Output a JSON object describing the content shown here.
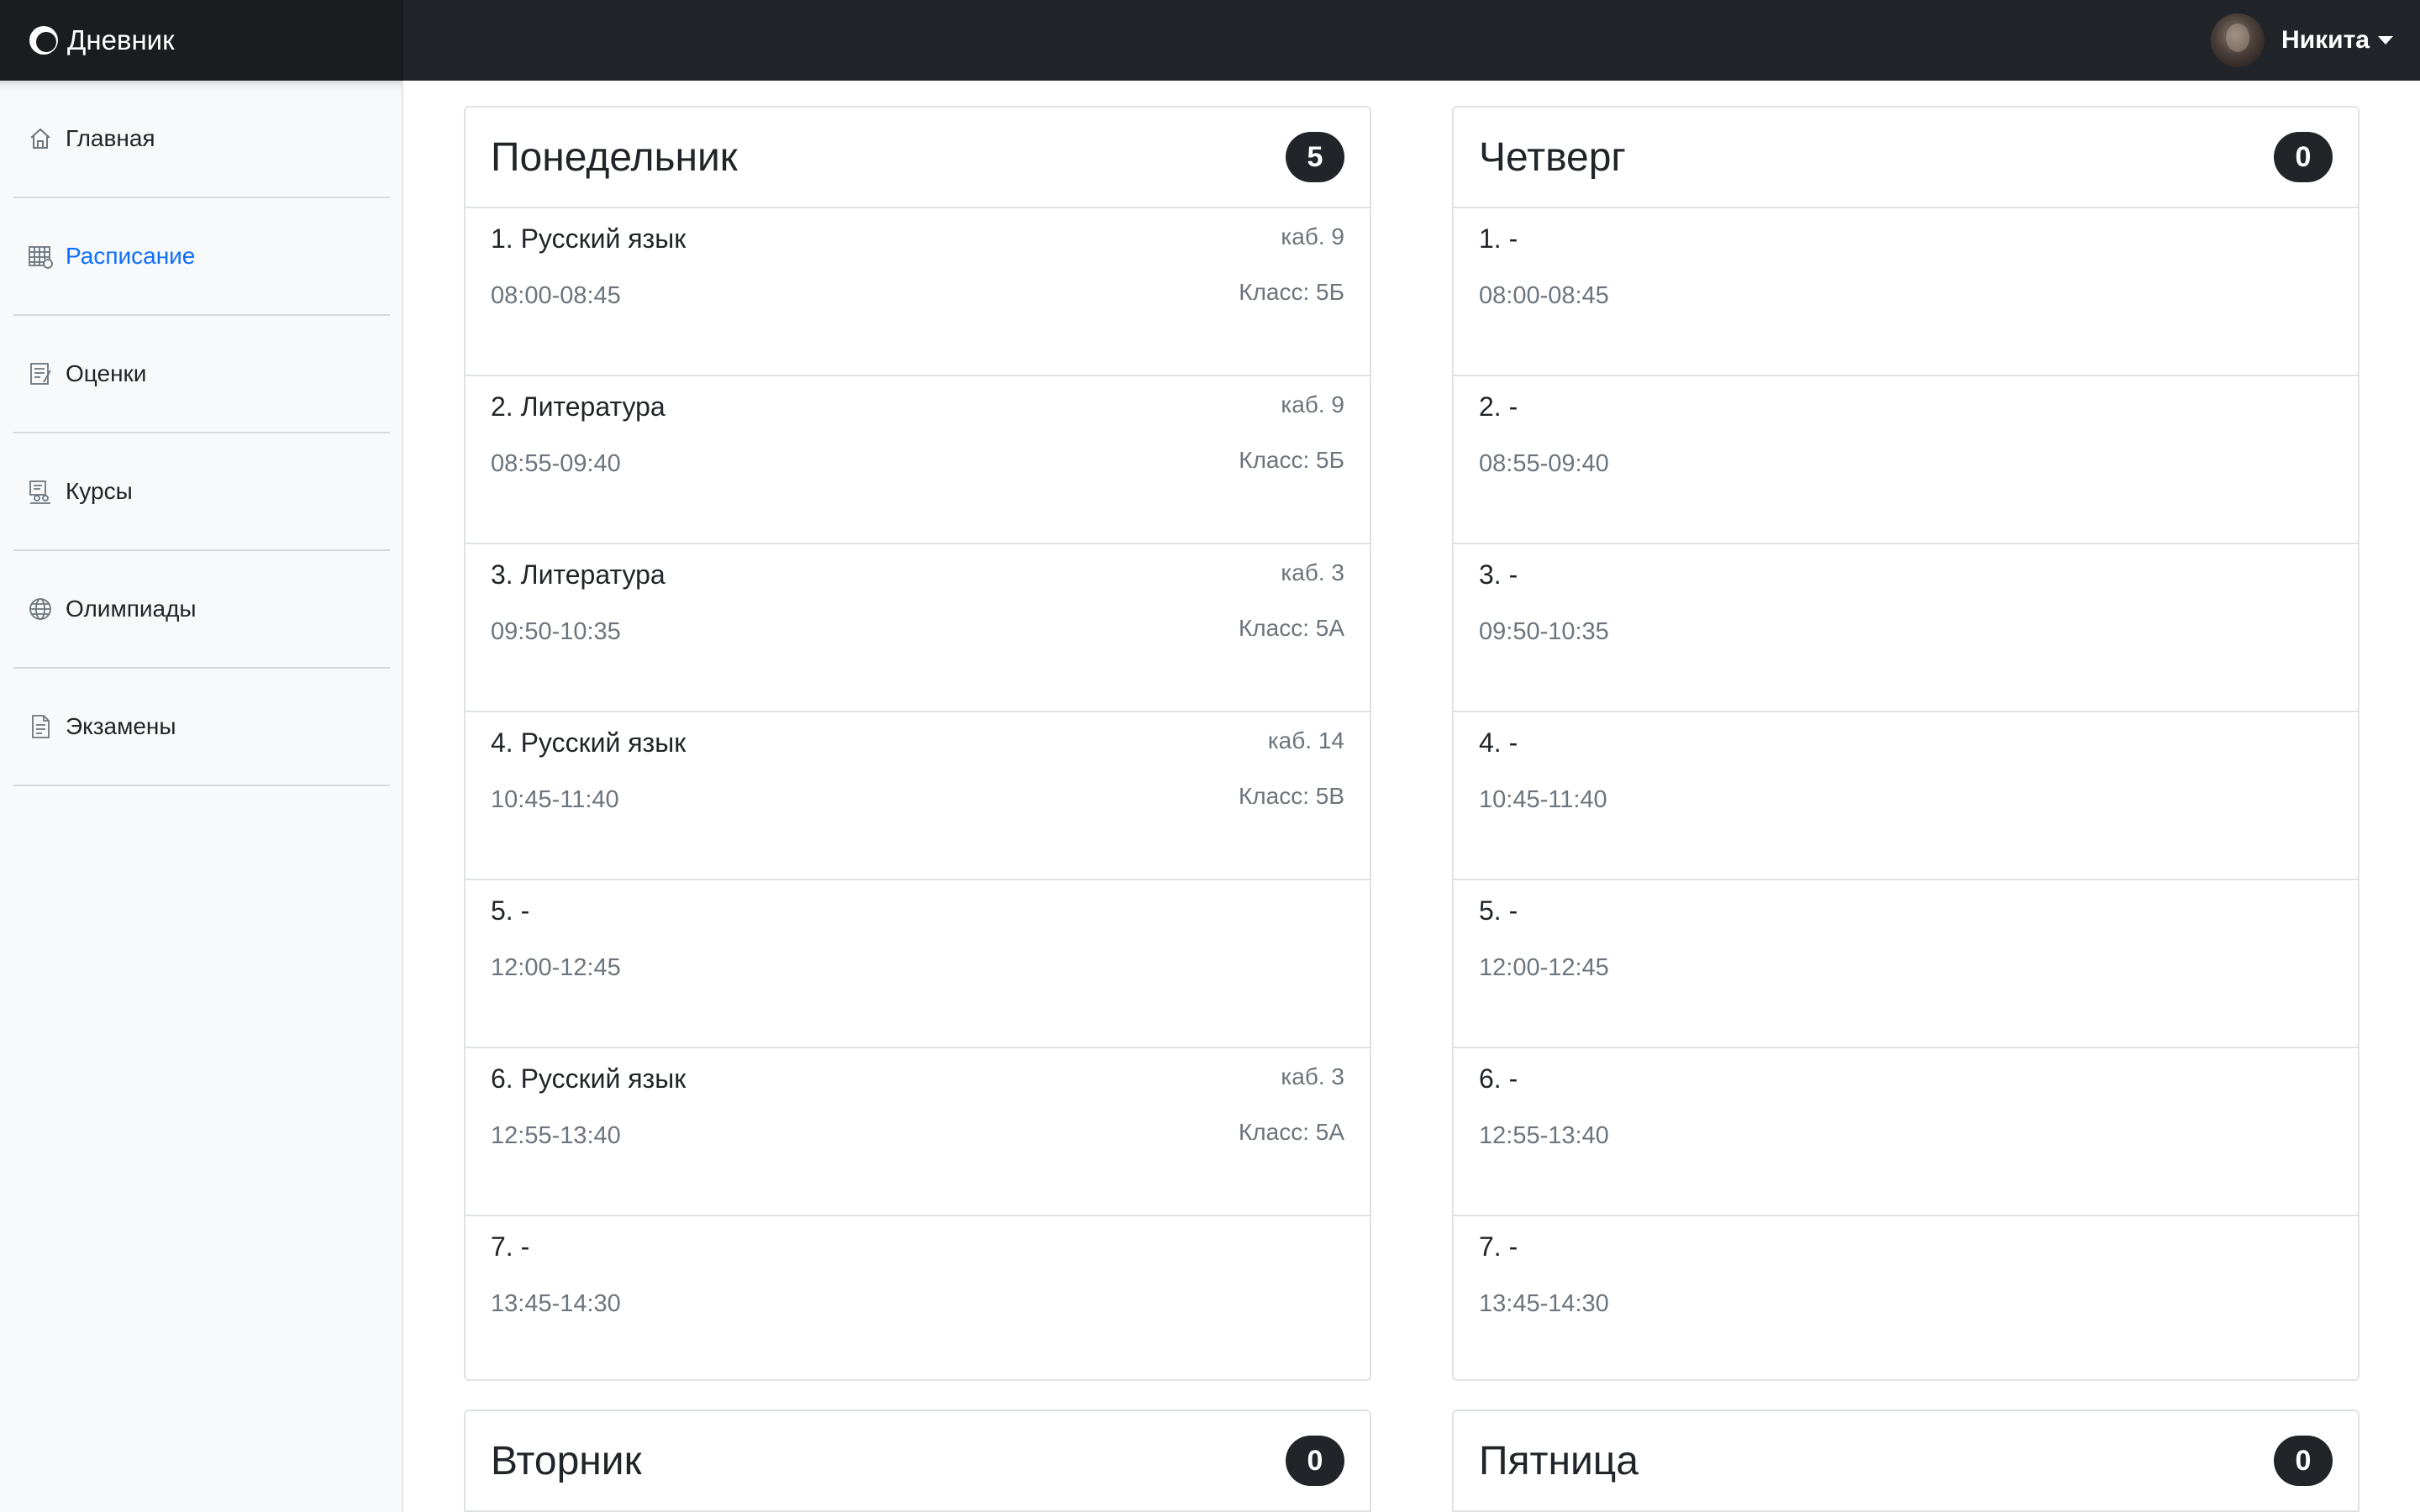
{
  "app": {
    "brand": "Дневник"
  },
  "user": {
    "name": "Никита"
  },
  "sidebar": {
    "items": [
      {
        "label": "Главная",
        "icon": "home-icon",
        "active": false
      },
      {
        "label": "Расписание",
        "icon": "calendar-grid-icon",
        "active": true
      },
      {
        "label": "Оценки",
        "icon": "grades-note-icon",
        "active": false
      },
      {
        "label": "Курсы",
        "icon": "courses-icon",
        "active": false
      },
      {
        "label": "Олимпиады",
        "icon": "globe-icon",
        "active": false
      },
      {
        "label": "Экзамены",
        "icon": "document-icon",
        "active": false
      }
    ]
  },
  "colors": {
    "accent": "#0d6efd",
    "navbar": "#212529",
    "badge": "#212529"
  },
  "days": [
    {
      "name": "Понедельник",
      "count": "5",
      "lessons": [
        {
          "title": "1. Русский язык",
          "time": "08:00-08:45",
          "room": "каб. 9",
          "class": "Класс: 5Б"
        },
        {
          "title": "2. Литература",
          "time": "08:55-09:40",
          "room": "каб. 9",
          "class": "Класс: 5Б"
        },
        {
          "title": "3. Литература",
          "time": "09:50-10:35",
          "room": "каб. 3",
          "class": "Класс: 5А"
        },
        {
          "title": "4. Русский язык",
          "time": "10:45-11:40",
          "room": "каб. 14",
          "class": "Класс: 5В"
        },
        {
          "title": "5. -",
          "time": "12:00-12:45",
          "room": "",
          "class": ""
        },
        {
          "title": "6. Русский язык",
          "time": "12:55-13:40",
          "room": "каб. 3",
          "class": "Класс: 5А"
        },
        {
          "title": "7. -",
          "time": "13:45-14:30",
          "room": "",
          "class": ""
        }
      ]
    },
    {
      "name": "Четверг",
      "count": "0",
      "lessons": [
        {
          "title": "1. -",
          "time": "08:00-08:45",
          "room": "",
          "class": ""
        },
        {
          "title": "2. -",
          "time": "08:55-09:40",
          "room": "",
          "class": ""
        },
        {
          "title": "3. -",
          "time": "09:50-10:35",
          "room": "",
          "class": ""
        },
        {
          "title": "4. -",
          "time": "10:45-11:40",
          "room": "",
          "class": ""
        },
        {
          "title": "5. -",
          "time": "12:00-12:45",
          "room": "",
          "class": ""
        },
        {
          "title": "6. -",
          "time": "12:55-13:40",
          "room": "",
          "class": ""
        },
        {
          "title": "7. -",
          "time": "13:45-14:30",
          "room": "",
          "class": ""
        }
      ]
    },
    {
      "name": "Вторник",
      "count": "0",
      "lessons": []
    },
    {
      "name": "Пятница",
      "count": "0",
      "lessons": []
    }
  ]
}
